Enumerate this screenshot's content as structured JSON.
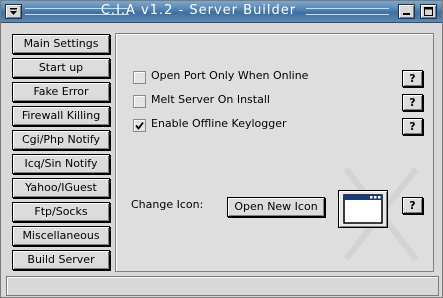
{
  "window": {
    "title": "C.I.A  v1.2 - Server Builder",
    "titlebar_color": "#5a8ab8",
    "system_menu_icon": "menu-arrow-icon",
    "minimize_icon": "minimize-icon",
    "maximize_icon": "maximize-icon"
  },
  "nav": {
    "items": [
      {
        "label": "Main Settings"
      },
      {
        "label": "Start up"
      },
      {
        "label": "Fake Error"
      },
      {
        "label": "Firewall Killing"
      },
      {
        "label": "Cgi/Php Notify"
      },
      {
        "label": "Icq/Sin Notify"
      },
      {
        "label": "Yahoo/IGuest"
      },
      {
        "label": "Ftp/Socks"
      },
      {
        "label": "Miscellaneous"
      },
      {
        "label": "Build Server"
      }
    ]
  },
  "options": [
    {
      "label": "Open Port Only When Online",
      "checked": false
    },
    {
      "label": "Melt Server On Install",
      "checked": false
    },
    {
      "label": "Enable Offline Keylogger",
      "checked": true
    }
  ],
  "help_label": "?",
  "icon": {
    "label": "Change Icon:",
    "button_label": "Open New Icon",
    "preview_icon": "window-icon"
  }
}
